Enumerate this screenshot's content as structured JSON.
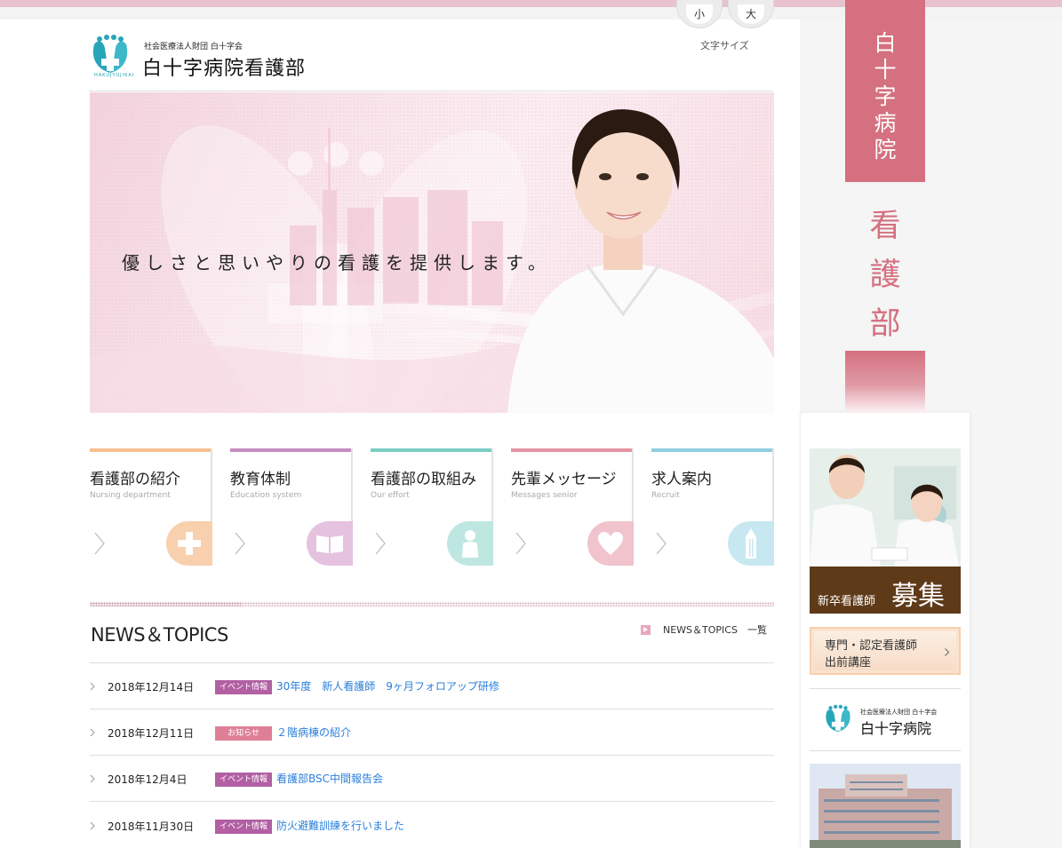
{
  "header": {
    "org_sub": "社会医療法人財団 白十字会",
    "site_title": "白十字病院看護部",
    "logo_en": "HAKUJYUJIKAI",
    "font_size": {
      "small": "小",
      "large": "大",
      "label": "文字サイズ"
    }
  },
  "hero": {
    "tagline": "優しさと思いやりの看護を提供します。"
  },
  "nav": [
    {
      "title": "看護部の紹介",
      "en": "Nursing department",
      "color": "#f6c08f",
      "icon": "plus-icon"
    },
    {
      "title": "教育体制",
      "en": "Education system",
      "color": "#c58bc0",
      "icon": "book-icon"
    },
    {
      "title": "看護部の取組み",
      "en": "Our effort",
      "color": "#7ccdc2",
      "icon": "person-icon"
    },
    {
      "title": "先輩メッセージ",
      "en": "Messages senior",
      "color": "#e394a4",
      "icon": "heart-icon"
    },
    {
      "title": "求人案内",
      "en": "Recruit",
      "color": "#8ecfe0",
      "icon": "pencil-icon"
    }
  ],
  "news": {
    "heading": "NEWS＆TOPICS",
    "more_label": "NEWS＆TOPICS　一覧",
    "items": [
      {
        "date": "2018年12月14日",
        "badge": "イベント情報",
        "badge_type": "event",
        "title": "30年度　新人看護師　9ヶ月フォロアップ研修"
      },
      {
        "date": "2018年12月11日",
        "badge": "お知らせ",
        "badge_type": "notice",
        "title": "２階病棟の紹介"
      },
      {
        "date": "2018年12月4日",
        "badge": "イベント情報",
        "badge_type": "event",
        "title": "看護部BSC中間報告会"
      },
      {
        "date": "2018年11月30日",
        "badge": "イベント情報",
        "badge_type": "event",
        "title": "防火避難訓練を行いました"
      }
    ]
  },
  "sidebar": {
    "banner_text": "白十字病院",
    "kango_text": "看護部",
    "recruit_small": "新卒看護師",
    "recruit_big": "募集",
    "course_line1": "専門・認定看護師",
    "course_line2": "出前講座",
    "hospital_sub": "社会医療法人財団 白十字会",
    "hospital_title": "白十字病院"
  },
  "colors": {
    "accent_pink": "#d4707f",
    "event_badge": "#b25fa3",
    "notice_badge": "#df7f96",
    "link": "#2b7fd9"
  }
}
